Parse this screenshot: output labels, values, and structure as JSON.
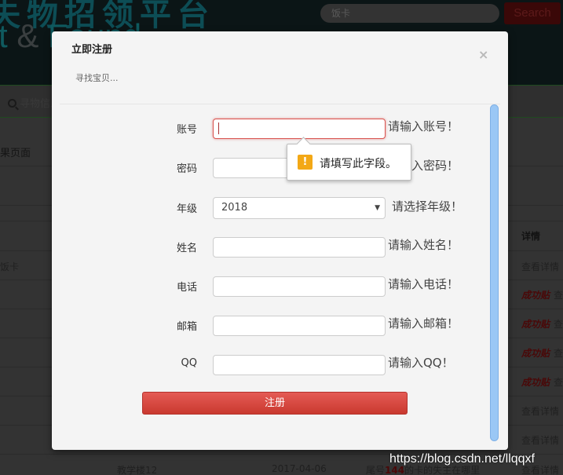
{
  "background": {
    "site_title_cn": "失物招领平台",
    "site_title_en_prefix": "t ",
    "site_title_en_amp": "&",
    "site_title_en_suffix": " Found",
    "search": {
      "value": "饭卡"
    },
    "search_button": "Search",
    "nav": {
      "item": "寻物信息",
      "icon": "search-icon"
    },
    "result_title": "果页面",
    "table": {
      "detail_header": "详情",
      "first_row_item": "饭卡",
      "view_label": "查看详情",
      "success_label": "成功贴",
      "view_partial": "查",
      "last_row": {
        "location": "教学楼12",
        "date": "2017-04-06",
        "title_prefix": "尾号",
        "title_number": "144",
        "title_suffix": "的卡的失主在哪里"
      }
    }
  },
  "modal": {
    "title": "立即注册",
    "subtitle": "寻找宝贝...",
    "close_icon": "close-icon",
    "fields": [
      {
        "label": "账号",
        "type": "text",
        "value": "",
        "hint": "请输入账号！",
        "state": "error"
      },
      {
        "label": "密码",
        "type": "password",
        "value": "",
        "hint": "请输入密码！"
      },
      {
        "label": "年级",
        "type": "select",
        "value": "2018",
        "hint": "请选择年级！"
      },
      {
        "label": "姓名",
        "type": "text",
        "value": "",
        "hint": "请输入姓名！"
      },
      {
        "label": "电话",
        "type": "text",
        "value": "",
        "hint": "请输入电话！"
      },
      {
        "label": "邮箱",
        "type": "text",
        "value": "",
        "hint": "请输入邮箱！"
      },
      {
        "label": "QQ",
        "type": "text",
        "value": "",
        "hint": "请输入QQ！"
      }
    ],
    "submit_label": "注册",
    "validation_tooltip": {
      "icon": "warning-icon",
      "text": "请填写此字段。"
    }
  },
  "colors": {
    "accent_red": "#d9534f",
    "scrollbar_blue": "#9ac7f5",
    "warning_orange": "#f3a816"
  },
  "watermark": "https://blog.csdn.net/llqqxf"
}
